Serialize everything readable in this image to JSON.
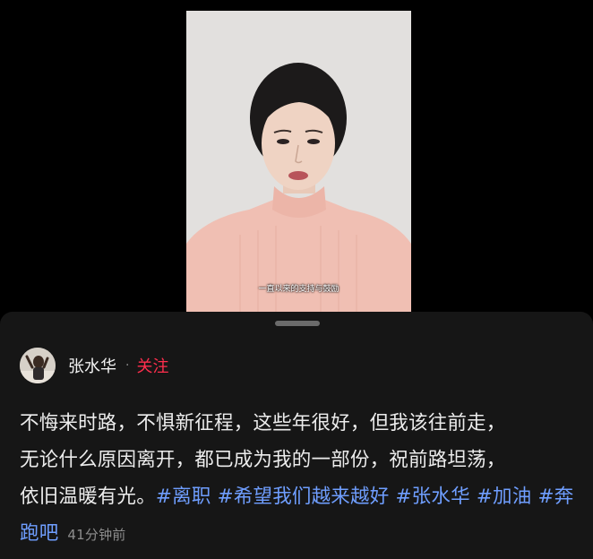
{
  "video": {
    "caption": "一直以来的支持与鼓励"
  },
  "author": {
    "name": "张水华",
    "separator": "·",
    "follow_label": "关注"
  },
  "post": {
    "lines": [
      "不悔来时路，不惧新征程，这些年很好，但我该往前走，",
      "无论什么原因离开，都已成为我的一部份，祝前路坦荡，",
      "依旧温暖有光。"
    ],
    "tags": [
      "#离职",
      "#希望我们越来越好",
      "#张水华",
      "#加油",
      "#奔跑吧"
    ],
    "time": "41分钟前"
  },
  "colors": {
    "accent_follow": "#ff2e4d",
    "hashtag": "#6f9eff",
    "sheet_bg": "#161616"
  }
}
